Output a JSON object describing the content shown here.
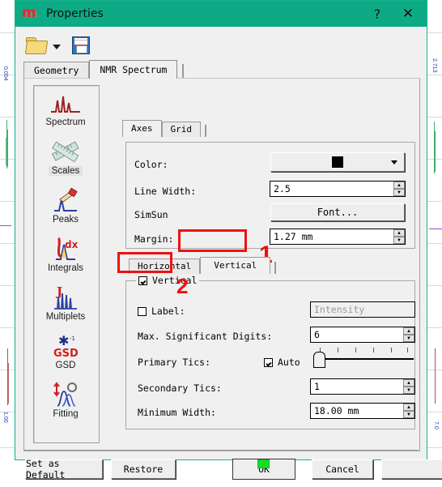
{
  "window": {
    "title": "Properties",
    "logo_icon": "mnova-m-logo-icon",
    "help_label": "?",
    "close_label": "✕",
    "titlebar_color": "#0cab85"
  },
  "toolbar": {
    "open_icon": "open-folder-icon",
    "open_dropdown_icon": "chevron-down-icon",
    "save_icon": "floppy-save-icon"
  },
  "outer_tabs": [
    {
      "label": "Geometry",
      "active": false
    },
    {
      "label": "NMR Spectrum",
      "active": true
    }
  ],
  "sidebar": {
    "items": [
      {
        "label": "Spectrum",
        "icon": "spectrum-peaks-icon",
        "selected": false
      },
      {
        "label": "Scales",
        "icon": "rulers-icon",
        "selected": true
      },
      {
        "label": "Peaks",
        "icon": "hand-pointer-peak-icon",
        "selected": false
      },
      {
        "label": "Integrals",
        "icon": "integral-dx-icon",
        "selected": false
      },
      {
        "label": "Multiplets",
        "icon": "j-multiplets-icon",
        "selected": false
      },
      {
        "label": "GSD",
        "icon": "gsd-asterisk-icon",
        "selected": false
      },
      {
        "label": "Fitting",
        "icon": "fitting-curves-icon",
        "selected": false
      }
    ]
  },
  "inner_tabs": [
    {
      "label": "Axes",
      "active": true
    },
    {
      "label": "Grid",
      "active": false
    }
  ],
  "axes_group": {
    "color": {
      "label": "Color:",
      "value_color": "#000000",
      "dropdown_icon": "chevron-down-icon"
    },
    "line_width": {
      "label": "Line Width:",
      "value": "2.5"
    },
    "font": {
      "label": "SimSun",
      "button_label": "Font..."
    },
    "margin": {
      "label": "Margin:",
      "value": "1.27 mm"
    }
  },
  "hv_tabs": [
    {
      "label": "Horizontal",
      "active": false
    },
    {
      "label": "Vertical",
      "active": true
    }
  ],
  "vertical_group": {
    "enable": {
      "label": "Vertical",
      "checked": true
    },
    "axis_label": {
      "label": "Label:",
      "checked": false,
      "value": "Intensity",
      "readonly": true
    },
    "max_significant_digits": {
      "label": "Max. Significant Digits:",
      "value": "6"
    },
    "primary_tics": {
      "label": "Primary Tics:",
      "auto_label": "Auto",
      "auto_checked": true,
      "slider_ticks": 6,
      "slider_position_pct": 12
    },
    "secondary_tics": {
      "label": "Secondary Tics:",
      "value": "1"
    },
    "minimum_width": {
      "label": "Minimum Width:",
      "value": "18.00 mm"
    }
  },
  "annotations": [
    {
      "number": "1",
      "target": "vertical-tab"
    },
    {
      "number": "2",
      "target": "vertical-checkbox"
    }
  ],
  "buttons": {
    "set_as_default": "Set as Default",
    "restore": "Restore",
    "ok": "OK",
    "cancel": "Cancel",
    "extra": ""
  },
  "resize_handle_color": "#19dd19"
}
